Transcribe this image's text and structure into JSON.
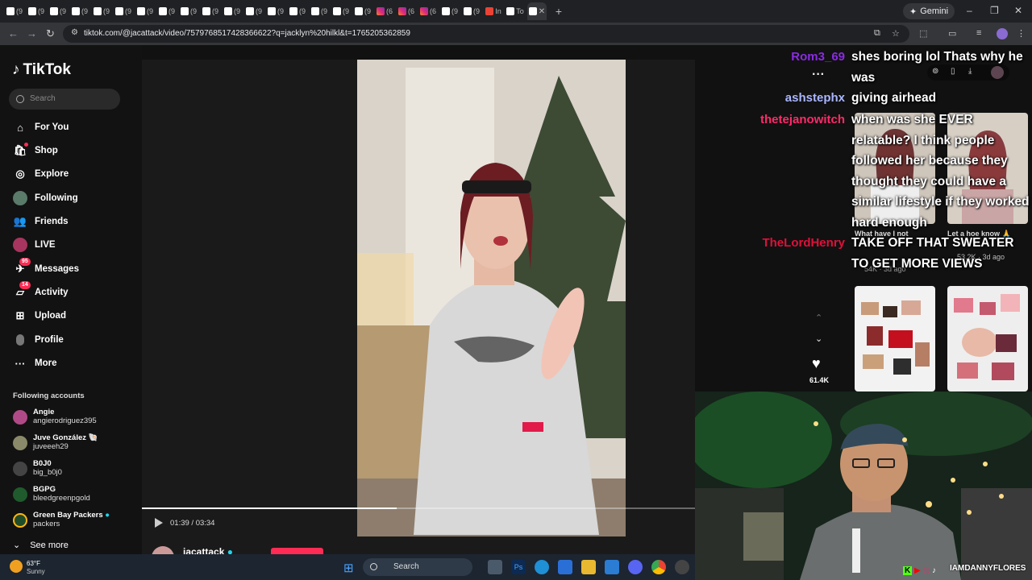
{
  "browser": {
    "tab_label_short": "(9",
    "tab_label_ig": "(6",
    "tab_label_in": "In",
    "tab_label_to": "To",
    "gemini_label": "Gemini",
    "url": "tiktok.com/@jacattack/video/7579768517428366622?q=jacklyn%20hilkl&t=1765205362859"
  },
  "sidebar": {
    "logo": "TikTok",
    "search_placeholder": "Search",
    "items": [
      {
        "label": "For You",
        "icon": "home-icon"
      },
      {
        "label": "Shop",
        "icon": "shop-icon"
      },
      {
        "label": "Explore",
        "icon": "compass-icon"
      },
      {
        "label": "Following",
        "icon": "following-avatar-icon"
      },
      {
        "label": "Friends",
        "icon": "friends-icon"
      },
      {
        "label": "LIVE",
        "icon": "live-icon"
      },
      {
        "label": "Messages",
        "icon": "messages-icon",
        "badge": "95"
      },
      {
        "label": "Activity",
        "icon": "activity-icon",
        "badge": "14"
      },
      {
        "label": "Upload",
        "icon": "upload-icon"
      },
      {
        "label": "Profile",
        "icon": "profile-icon"
      },
      {
        "label": "More",
        "icon": "more-dots-icon"
      }
    ],
    "following_title": "Following accounts",
    "accounts": [
      {
        "name": "Angie",
        "handle": "angierodriguez395"
      },
      {
        "name": "Juve González 🐚",
        "handle": "juveeeh29"
      },
      {
        "name": "B0J0",
        "handle": "big_b0j0"
      },
      {
        "name": "BGPG",
        "handle": "bleedgreenpgold"
      },
      {
        "name": "Green Bay Packers",
        "handle": "packers"
      }
    ],
    "see_more": "See more"
  },
  "player": {
    "time": "01:39 / 03:34",
    "progress": 0.46,
    "author": "jacattack",
    "likes": "61.4K"
  },
  "related": [
    {
      "caption": "What have I not",
      "meta": "54K · 3d ago"
    },
    {
      "caption": "Let a hoe know 🙏",
      "meta": "53.2K · 3d ago"
    }
  ],
  "chat": [
    {
      "user": "Rom3_69",
      "color": "#8a2be2",
      "message": "shes boring lol Thats why he was"
    },
    {
      "user": "ashstephx",
      "color": "#aab6ff",
      "message": "giving airhead"
    },
    {
      "user": "thetejanowitch",
      "color": "#ff2a6a",
      "message": "when was she EVER relatable? I think people followed her because they thought they could have a similar lifestyle if they worked hard enough"
    },
    {
      "user": "TheLordHenry",
      "color": "#e0103a",
      "message": "TAKE OFF THAT SWEATER TO GET MORE VIEWS"
    }
  ],
  "webcam": {
    "handle": "IAMDANNYFLORES"
  },
  "taskbar": {
    "temp": "63°F",
    "weather": "Sunny",
    "search": "Search"
  }
}
